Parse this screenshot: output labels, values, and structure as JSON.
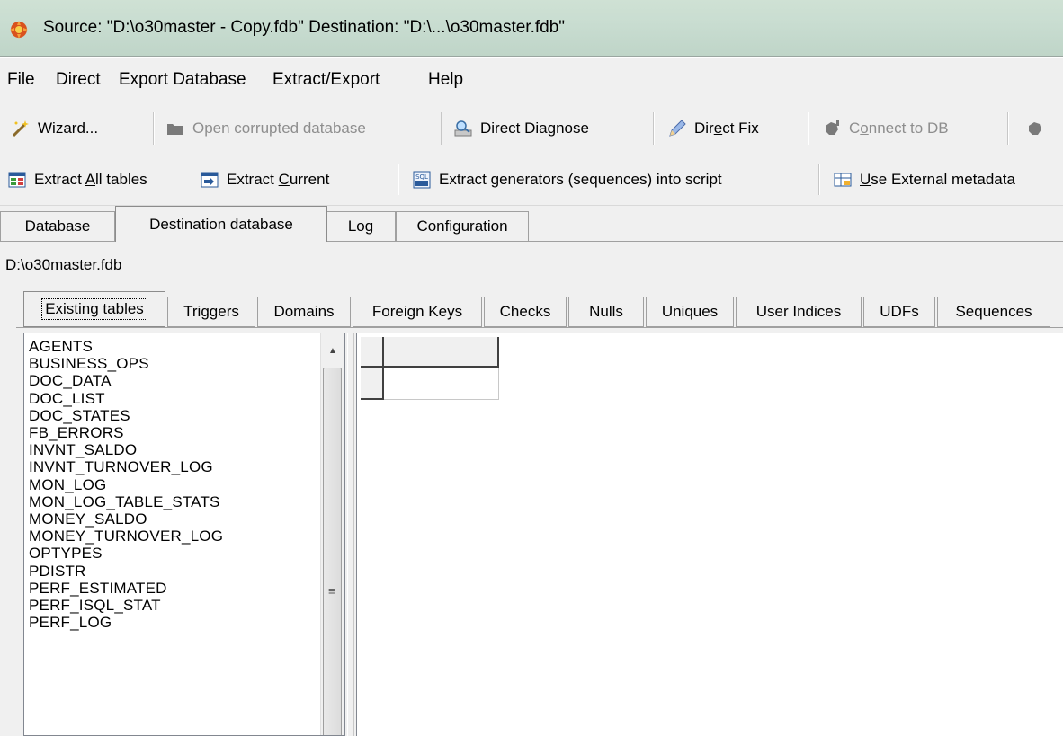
{
  "window": {
    "title": "Source: \"D:\\o30master - Copy.fdb\" Destination: \"D:\\...\\o30master.fdb\""
  },
  "menu": [
    "File",
    "Direct",
    "Export Database",
    "Extract/Export",
    "Help"
  ],
  "toolbar1": {
    "wizard": "Wizard...",
    "open_corrupted": "Open corrupted database",
    "direct_diagnose": "Direct Diagnose",
    "direct_fix_pre": "Dir",
    "direct_fix_u": "e",
    "direct_fix_post": "ct Fix",
    "connect_pre": "C",
    "connect_u": "o",
    "connect_post": "nnect to DB"
  },
  "toolbar2": {
    "extract_all_pre": "Extract ",
    "extract_all_u": "A",
    "extract_all_post": "ll tables",
    "extract_current_pre": "Extract ",
    "extract_current_u": "C",
    "extract_current_post": "urrent",
    "extract_generators": "Extract generators (sequences) into script",
    "use_external_u": "U",
    "use_external_post": "se External metadata"
  },
  "outer_tabs": [
    "Database",
    "Destination database",
    "Log",
    "Configuration"
  ],
  "active_outer_tab": "Destination database",
  "destination_path": "D:\\o30master.fdb",
  "inner_tabs": [
    "Existing tables",
    "Triggers",
    "Domains",
    "Foreign Keys",
    "Checks",
    "Nulls",
    "Uniques",
    "User Indices",
    "UDFs",
    "Sequences"
  ],
  "active_inner_tab": "Existing tables",
  "tables": [
    "AGENTS",
    "BUSINESS_OPS",
    "DOC_DATA",
    "DOC_LIST",
    "DOC_STATES",
    "FB_ERRORS",
    "INVNT_SALDO",
    "INVNT_TURNOVER_LOG",
    "MON_LOG",
    "MON_LOG_TABLE_STATS",
    "MONEY_SALDO",
    "MONEY_TURNOVER_LOG",
    "OPTYPES",
    "PDISTR",
    "PERF_ESTIMATED",
    "PERF_ISQL_STAT",
    "PERF_LOG"
  ],
  "colors": {
    "accent_title": "#c9ddd1",
    "disabled_text": "#8e8e8e"
  }
}
